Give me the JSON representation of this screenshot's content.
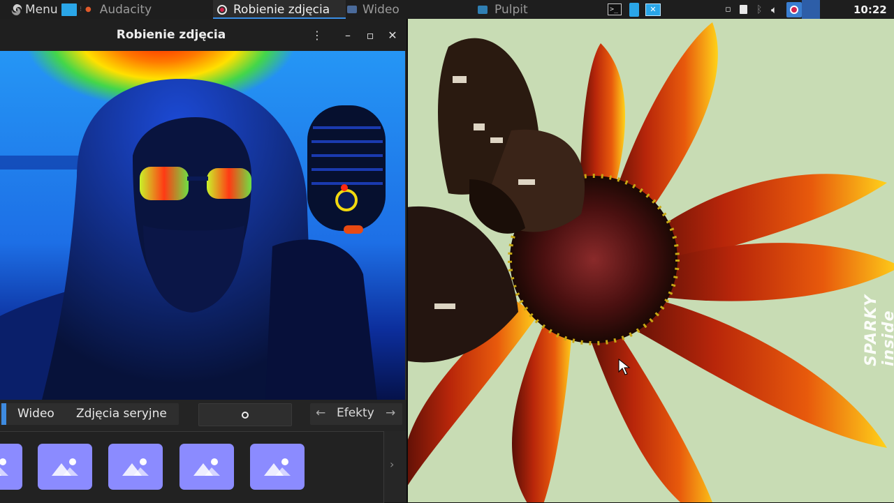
{
  "taskbar": {
    "menu_label": "Menu",
    "tasks": [
      {
        "label": "Audacity",
        "active": false
      },
      {
        "label": "Robienie zdjęcia",
        "active": true
      },
      {
        "label": "Wideo",
        "active": false
      },
      {
        "label": "Pulpit",
        "active": false
      }
    ],
    "clock": "10:22",
    "accent_color": "#3a8ee6"
  },
  "window": {
    "title": "Robienie zdjęcia",
    "icons": [
      "kebab-menu-icon",
      "minimize-icon",
      "maximize-icon",
      "close-icon"
    ]
  },
  "modebar": {
    "tabs": [
      "Wideo",
      "Zdjęcia seryjne"
    ],
    "effects_label": "Efekty"
  },
  "gallery": {
    "thumbnail_count": 5,
    "thumb_color": "#8b8bff"
  },
  "desktop": {
    "watermark": "SPARKY inside"
  }
}
